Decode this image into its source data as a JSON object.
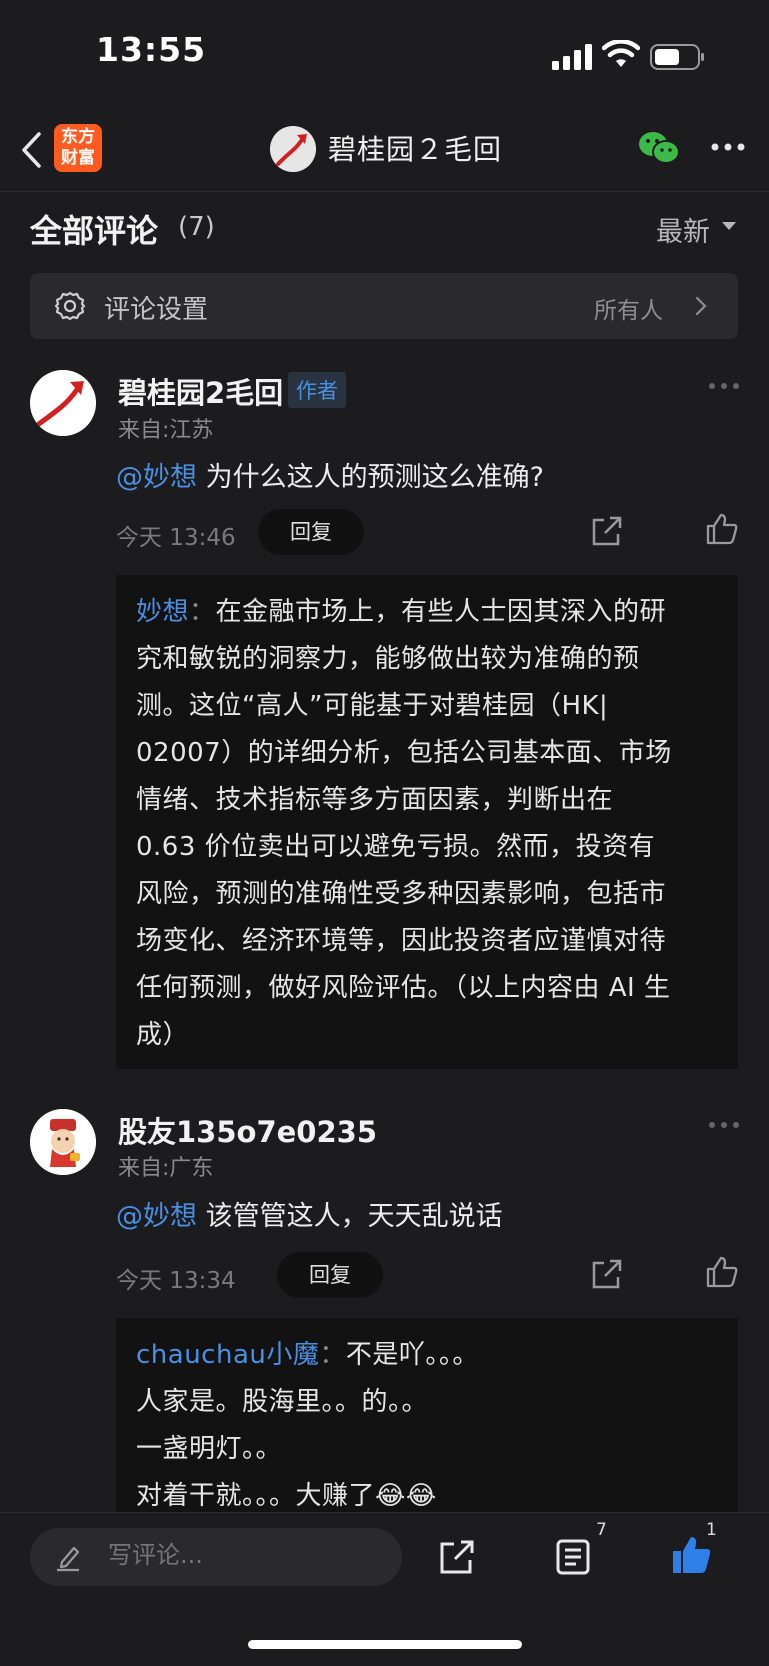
{
  "status_bar": {
    "time": "13:55"
  },
  "header": {
    "app_logo_text_1": "东方",
    "app_logo_text_2": "财富",
    "title": "碧桂园２毛回"
  },
  "comments_header": {
    "title": "全部评论",
    "count": "(7)",
    "sort": "最新"
  },
  "settings": {
    "label": "评论设置",
    "value": "所有人"
  },
  "comments": [
    {
      "name": "碧桂园2毛回",
      "badge": "作者",
      "location": "来自:江苏",
      "mention": "@妙想",
      "text": " 为什么这人的预测这么准确?",
      "time": "今天 13:46",
      "reply_label": "回复",
      "reply": {
        "author": "妙想",
        "sep": "：",
        "lines": [
          "在金融市场上，有些人士因其深入的研",
          "究和敏锐的洞察力，能够做出较为准确的预",
          "测。这位“高人”可能基于对碧桂园（HK|",
          "02007）的详细分析，包括公司基本面、市场",
          "情绪、技术指标等多方面因素，判断出在",
          " 0.63 价位卖出可以避免亏损。然而，投资有",
          "风险，预测的准确性受多种因素影响，包括市",
          "场变化、经济环境等，因此投资者应谨慎对待",
          "任何预测，做好风险评估。（以上内容由 AI 生",
          "成）"
        ]
      }
    },
    {
      "name": "股友135o7e0235",
      "location": "来自:广东",
      "mention": "@妙想",
      "text": " 该管管这人，天天乱说话",
      "time": "今天 13:34",
      "reply_label": "回复",
      "reply": {
        "author": "chauchau小魔",
        "sep": "：",
        "lines": [
          "不是吖。。。",
          "人家是。股海里。。的。。",
          "一盏明灯。。",
          "对着干就。。。大赚了😂😂"
        ]
      }
    }
  ],
  "bottom_bar": {
    "placeholder": "写评论...",
    "comment_count": "7",
    "like_count": "1"
  }
}
